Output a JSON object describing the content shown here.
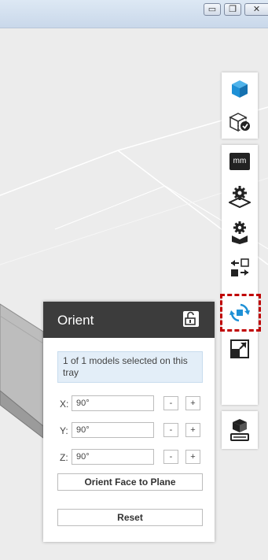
{
  "window": {
    "minimize_glyph": "▭",
    "restore_glyph": "❐",
    "close_glyph": "✕"
  },
  "toolbar": {
    "items": [
      {
        "name": "model-view-cube-icon"
      },
      {
        "name": "supports-check-icon"
      },
      {
        "name": "units-mm-button",
        "label": "mm"
      },
      {
        "name": "layout-gear-icon"
      },
      {
        "name": "settings-gear-icon"
      },
      {
        "name": "arrange-icon"
      },
      {
        "name": "orient-icon",
        "highlighted": true
      },
      {
        "name": "scale-icon"
      },
      {
        "name": "print-queue-icon"
      }
    ]
  },
  "orient_panel": {
    "title": "Orient",
    "selection_info": "1 of 1 models selected on this tray",
    "axes": [
      {
        "label": "X:",
        "value": "90°",
        "minus": "-",
        "plus": "+"
      },
      {
        "label": "Y:",
        "value": "90°",
        "minus": "-",
        "plus": "+"
      },
      {
        "label": "Z:",
        "value": "90°",
        "minus": "-",
        "plus": "+"
      }
    ],
    "orient_face_button": "Orient Face to Plane",
    "reset_button": "Reset"
  },
  "colors": {
    "accent_blue": "#1e90d6",
    "highlight_red": "#c00000",
    "panel_header": "#3c3c3c"
  }
}
